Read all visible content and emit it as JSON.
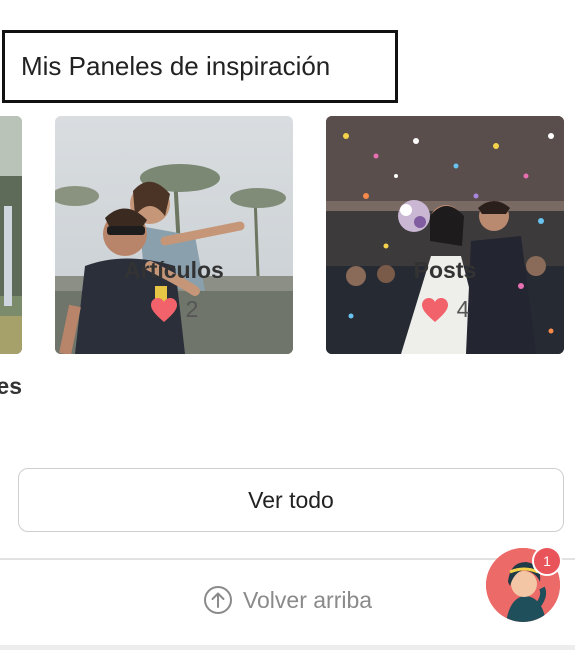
{
  "section": {
    "title": "Mis Paneles de inspiración"
  },
  "boards": [
    {
      "label": "es",
      "partial": true
    },
    {
      "label": "Artículos",
      "likes": "2",
      "image": "couple-piggyback-photo"
    },
    {
      "label": "Posts",
      "likes": "4",
      "image": "wedding-confetti-photo"
    }
  ],
  "actions": {
    "view_all": "Ver todo",
    "back_to_top": "Volver arriba"
  },
  "chat": {
    "badge_count": "1"
  },
  "colors": {
    "heart": "#f1626b",
    "avatar_bg": "#ec6a67",
    "badge": "#e8545a"
  }
}
